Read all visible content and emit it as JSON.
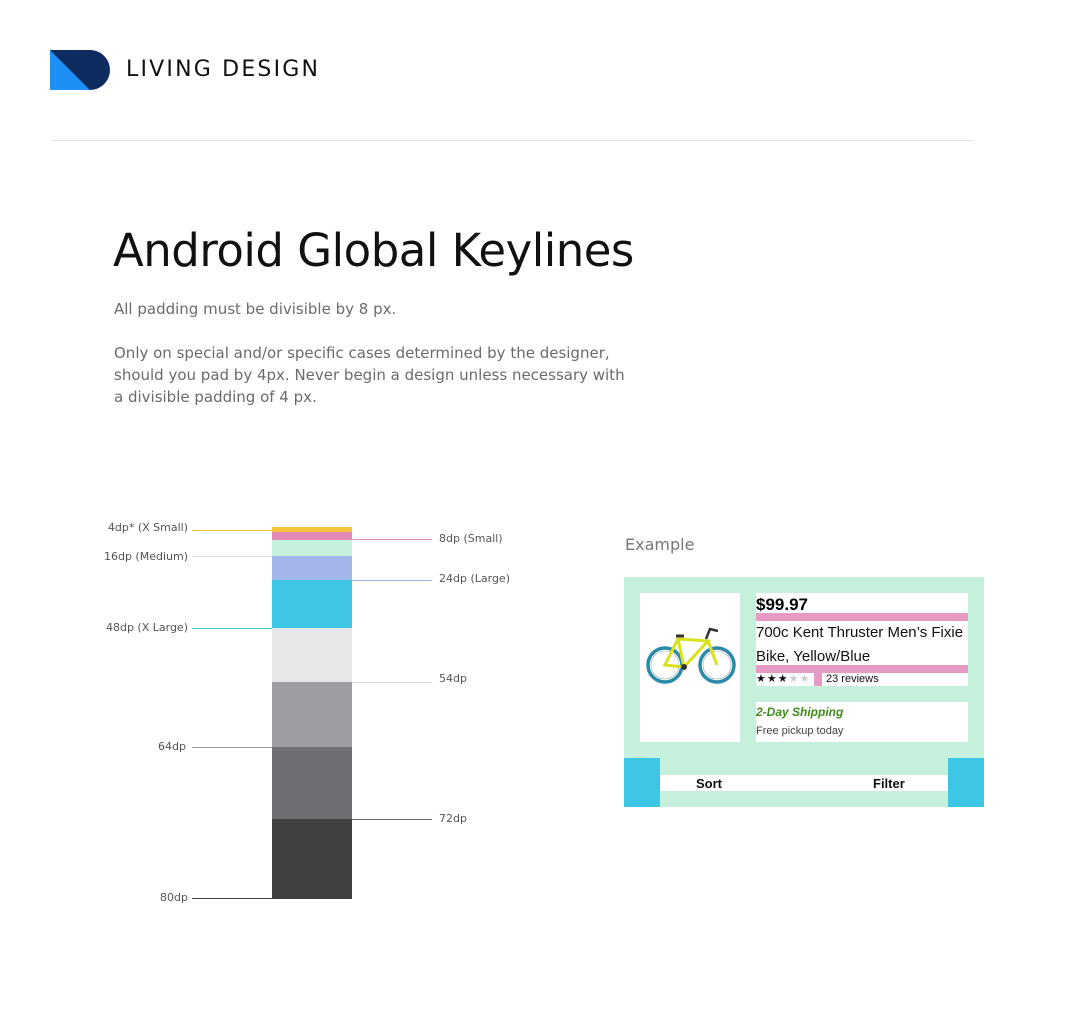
{
  "header": {
    "brand": "LIVING DESIGN",
    "logo_colors": {
      "dark": "#0d2b5e",
      "light": "#1e90f5"
    }
  },
  "page": {
    "title": "Android Global Keylines",
    "paragraph_1": "All padding must be divisible by 8 px.",
    "paragraph_2": "Only on special and/or specific cases determined by the designer, should you pad by 4px. Never begin a design unless necessary with a divisible padding of 4 px."
  },
  "keylines": {
    "labels": {
      "xsmall": "4dp* (X Small)",
      "small": "8dp (Small)",
      "medium": "16dp (Medium)",
      "large": "24dp (Large)",
      "xlarge": "48dp (X Large)",
      "s54": "54dp",
      "s64": "64dp",
      "s72": "72dp",
      "s80": "80dp"
    },
    "colors": {
      "xsmall": "#f5c23c",
      "small": "#e789b8",
      "medium": "#c5f1dc",
      "large": "#a3b6ea",
      "xlarge": "#3ec6e6",
      "s54": "#e6e7e8",
      "s64": "#9d9ea1",
      "s72": "#6e6f72",
      "s80": "#404042"
    }
  },
  "example": {
    "label": "Example",
    "price": "$99.97",
    "product_title": "700c Kent Thruster Men’s Fixie Bike, Yellow/Blue",
    "rating": 3,
    "rating_max": 5,
    "reviews": "23 reviews",
    "shipping": "2-Day Shipping",
    "pickup": "Free pickup today",
    "sort_label": "Sort",
    "filter_label": "Filter",
    "product_image_icon": "bicycle-image"
  }
}
